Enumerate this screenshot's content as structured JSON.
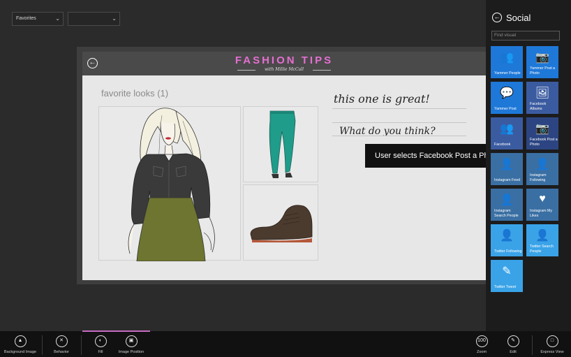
{
  "toolbar": {
    "dropdown1_value": "Favorites",
    "dropdown2_value": ""
  },
  "canvas": {
    "brand_title": "FASHION TIPS",
    "brand_subtitle": "with Millie McCall",
    "favorites_heading": "favorite looks (1)",
    "note1": "this one is great!",
    "note2": "What do you think?"
  },
  "tooltip": {
    "text": "User selects Facebook Post a Photo"
  },
  "pane": {
    "title": "Social",
    "find_placeholder": "Find visual",
    "tiles": [
      {
        "label": "Yammer People",
        "icon": "people-icon",
        "color": "#1e78d8"
      },
      {
        "label": "Yammer Post a Photo",
        "icon": "camera-icon",
        "color": "#1e78d8"
      },
      {
        "label": "Yammer Post",
        "icon": "message-icon",
        "color": "#1e78d8"
      },
      {
        "label": "Facebook Albums",
        "icon": "album-icon",
        "color": "#3b5ba0"
      },
      {
        "label": "Facebook",
        "icon": "people-icon",
        "color": "#3b5ba0"
      },
      {
        "label": "Facebook Post a Photo",
        "icon": "camera-icon",
        "color": "#2c4582"
      },
      {
        "label": "Instagram Feed",
        "icon": "feed-icon",
        "color": "#3a6fa3"
      },
      {
        "label": "Instagram Following",
        "icon": "following-icon",
        "color": "#3a6fa3"
      },
      {
        "label": "Instagram Search People",
        "icon": "search-people-icon",
        "color": "#3a6fa3"
      },
      {
        "label": "Instagram My Likes",
        "icon": "heart-icon",
        "color": "#3a6fa3"
      },
      {
        "label": "Twitter Following",
        "icon": "following-icon",
        "color": "#3aa3e8"
      },
      {
        "label": "Twitter Search People",
        "icon": "search-people-icon",
        "color": "#3aa3e8"
      },
      {
        "label": "Twitter Tweet",
        "icon": "compose-icon",
        "color": "#3aa3e8"
      }
    ]
  },
  "appbar": {
    "background_image": "Background Image",
    "behavior": "Behavior",
    "fill": "Fill",
    "image_position": "Image Position",
    "zoom_value": "100",
    "zoom": "Zoom",
    "edit": "Edit",
    "express_view": "Express View"
  }
}
